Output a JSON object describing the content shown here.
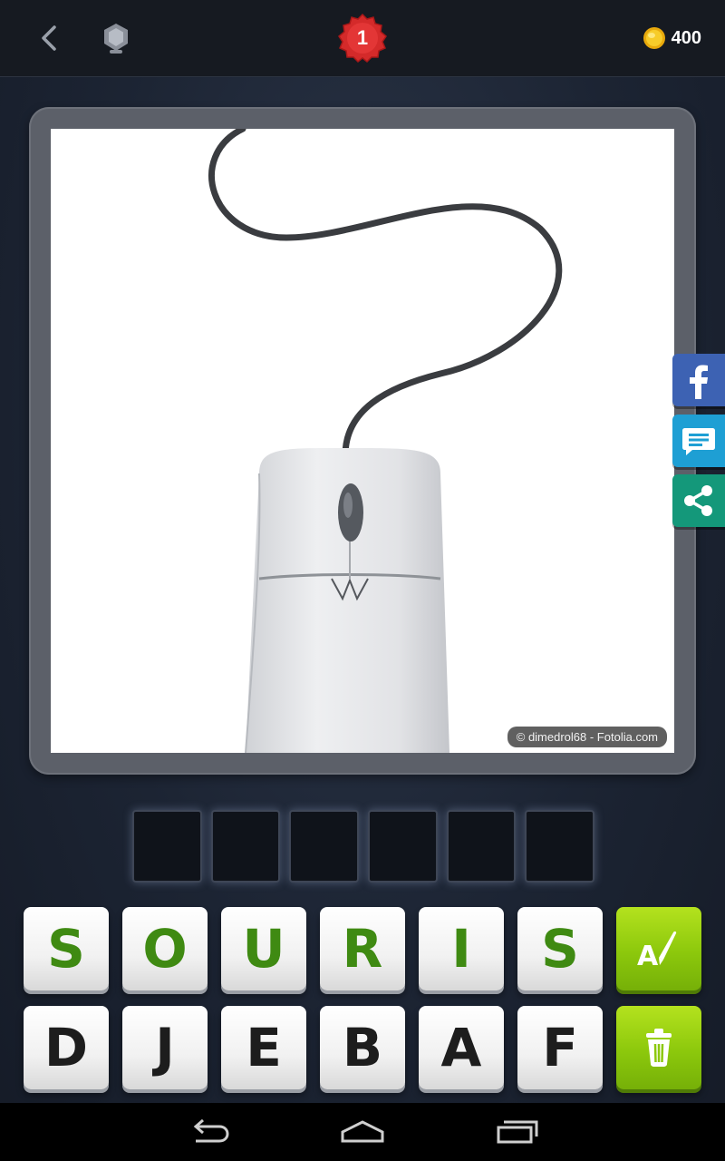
{
  "header": {
    "back_icon": "chevron-left-icon",
    "shield_icon": "shield-icon",
    "level": "1",
    "coins": "400",
    "coin_icon": "gold-coin-icon"
  },
  "puzzle": {
    "image_subject": "computer mouse",
    "credit": "© dimedrol68 - Fotolia.com"
  },
  "side_buttons": [
    {
      "icon": "facebook-icon"
    },
    {
      "icon": "message-icon"
    },
    {
      "icon": "share-icon"
    }
  ],
  "answer_slots": [
    "",
    "",
    "",
    "",
    "",
    ""
  ],
  "letters_row1": [
    "S",
    "O",
    "U",
    "R",
    "I",
    "S"
  ],
  "letters_row2": [
    "D",
    "J",
    "E",
    "B",
    "A",
    "F"
  ],
  "tools": {
    "reveal_icon": "reveal-letter-icon",
    "remove_icon": "trash-icon"
  },
  "colors": {
    "accent_green": "#8cc80c",
    "level_badge": "#d42a2a",
    "letter_green": "#3f8a12"
  }
}
